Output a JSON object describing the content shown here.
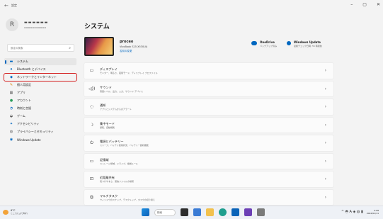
{
  "window": {
    "back_glyph": "←",
    "title": "設定",
    "minimize": "–",
    "maximize": "▢",
    "close": "✕"
  },
  "user": {
    "avatar_glyph": "R",
    "name": "▬▬▬▬▬▬",
    "sub": "▬▬▬▬▬▬▬▬▬▬▬"
  },
  "search": {
    "placeholder": "設定の検索",
    "icon": "search-icon"
  },
  "sidebar": {
    "items": [
      {
        "label": "システム",
        "icon": "▬",
        "color": "#0067c0"
      },
      {
        "label": "Bluetooth とデバイス",
        "icon": "ʙ",
        "color": "#0067c0"
      },
      {
        "label": "ネットワークとインターネット",
        "icon": "◆",
        "color": "#0067c0"
      },
      {
        "label": "個人用設定",
        "icon": "✎",
        "color": "#d47f00"
      },
      {
        "label": "アプリ",
        "icon": "▦",
        "color": "#555"
      },
      {
        "label": "アカウント",
        "icon": "●",
        "color": "#2a9d5a"
      },
      {
        "label": "時刻と言語",
        "icon": "◔",
        "color": "#0067c0"
      },
      {
        "label": "ゲーム",
        "icon": "◒",
        "color": "#555"
      },
      {
        "label": "アクセシビリティ",
        "icon": "✦",
        "color": "#0067c0"
      },
      {
        "label": "プライバシーとセキュリティ",
        "icon": "◍",
        "color": "#555"
      },
      {
        "label": "Windows Update",
        "icon": "◉",
        "color": "#0067c0"
      }
    ]
  },
  "page": {
    "title": "システム"
  },
  "device": {
    "name": "proceo",
    "model": "VivoBook S15 X530UA",
    "rename": "名前の変更"
  },
  "services": [
    {
      "title": "OneDrive",
      "sub": "バックアップ済み"
    },
    {
      "title": "Windows Update",
      "sub": "最終チェック日時: 55 時間前"
    }
  ],
  "cards": [
    {
      "title": "ディスプレイ",
      "sub": "モニター、明るさ、夜間モード、ディスプレイ プロファイル",
      "icon": "▭"
    },
    {
      "title": "サウンド",
      "sub": "音量レベル、出力、入力、サウンド デバイス",
      "icon": "◁))"
    },
    {
      "title": "通知",
      "sub": "アプリとシステムからのアラート",
      "icon": "◌"
    },
    {
      "title": "集中モード",
      "sub": "通知、自動規則",
      "icon": "☽"
    },
    {
      "title": "電源とバッテリー",
      "sub": "スリープ、バッテリ使用状況、バッテリー節約機能",
      "icon": "⏻"
    },
    {
      "title": "記憶域",
      "sub": "ストレージ領域、ドライブ、構成ルール",
      "icon": "▭"
    },
    {
      "title": "近距離共有",
      "sub": "見つけやすさ、受信ファイルの場所",
      "icon": "⊡"
    },
    {
      "title": "マルチタスク",
      "sub": "ウィンドウのスナップ、デスクトップ、タスクの切り替え",
      "icon": "⧉"
    }
  ],
  "chevron": "›",
  "taskbar": {
    "weather_temp": "6°C",
    "weather_desc": "ところにより晴れ",
    "search_label": "検索",
    "time": "4:08",
    "date": "2022/01/11",
    "tray_icons": "^ ◓ A ◈ ◍ ▮"
  },
  "colors": {
    "accent": "#0067c0",
    "highlight_box": "#d42020"
  }
}
